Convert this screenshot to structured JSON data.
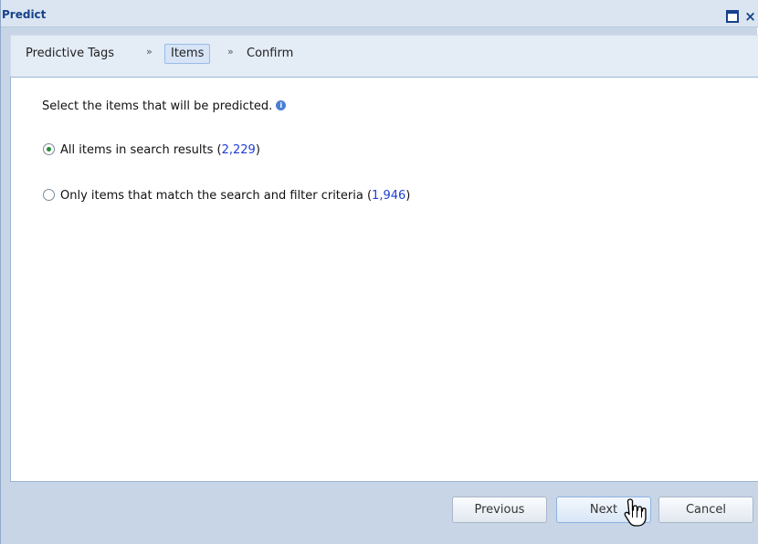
{
  "window": {
    "title": "Predict"
  },
  "breadcrumb": {
    "steps": [
      "Predictive Tags",
      "Items",
      "Confirm"
    ],
    "separator": "»",
    "active_index": 1
  },
  "content": {
    "instruction": "Select the items that will be predicted.",
    "options": [
      {
        "label": "All items in search results (",
        "count": "2,229",
        "suffix": ")",
        "selected": true
      },
      {
        "label": "Only items that match the search and filter criteria (",
        "count": "1,946",
        "suffix": ")",
        "selected": false
      }
    ]
  },
  "buttons": {
    "previous": "Previous",
    "next": "Next",
    "cancel": "Cancel"
  },
  "icons": {
    "maximize": "maximize-icon",
    "close": "close-icon",
    "info": "info-icon",
    "cursor": "hand-pointer-icon"
  },
  "colors": {
    "title_text": "#15428b",
    "count_link": "#1f3fd1",
    "panel_bg": "#c7d5e6"
  }
}
